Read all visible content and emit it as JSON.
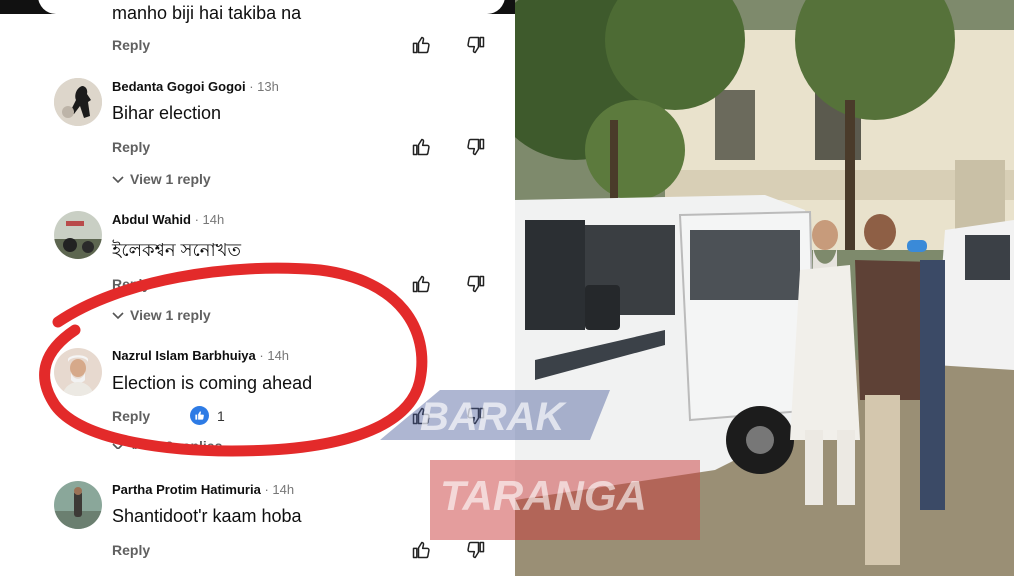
{
  "comments": [
    {
      "author": "",
      "time": "",
      "text": "manho biji hai takiba na",
      "reply": "Reply"
    },
    {
      "author": "Bedanta Gogoi Gogoi",
      "time": "· 13h",
      "text": "Bihar election",
      "reply": "Reply",
      "view_replies": "View 1 reply"
    },
    {
      "author": "Abdul Wahid",
      "time": "· 14h",
      "text": "ইলেকশ্বন সনোখত",
      "reply": "Reply",
      "view_replies": "View 1 reply"
    },
    {
      "author": "Nazrul Islam Barbhuiya",
      "time": "· 14h",
      "text": "Election is coming ahead",
      "reply": "Reply",
      "likes": "1",
      "view_replies": "View 2 replies"
    },
    {
      "author": "Partha Protim Hatimuria",
      "time": "· 14h",
      "text": "Shantidoot'r kaam hoba",
      "reply": "Reply"
    }
  ],
  "watermark": {
    "line1": "BARAK",
    "line2": "TARANGA"
  },
  "icons": {
    "like": "thumbs-up-icon",
    "dislike": "thumbs-down-icon",
    "chevron": "chevron-down-icon",
    "like_badge": "thumbs-up-badge-icon"
  },
  "colors": {
    "highlight_ring": "#e32a2a",
    "like_badge": "#2d7be5",
    "text": "#0f0f0f",
    "secondary": "#606060"
  }
}
